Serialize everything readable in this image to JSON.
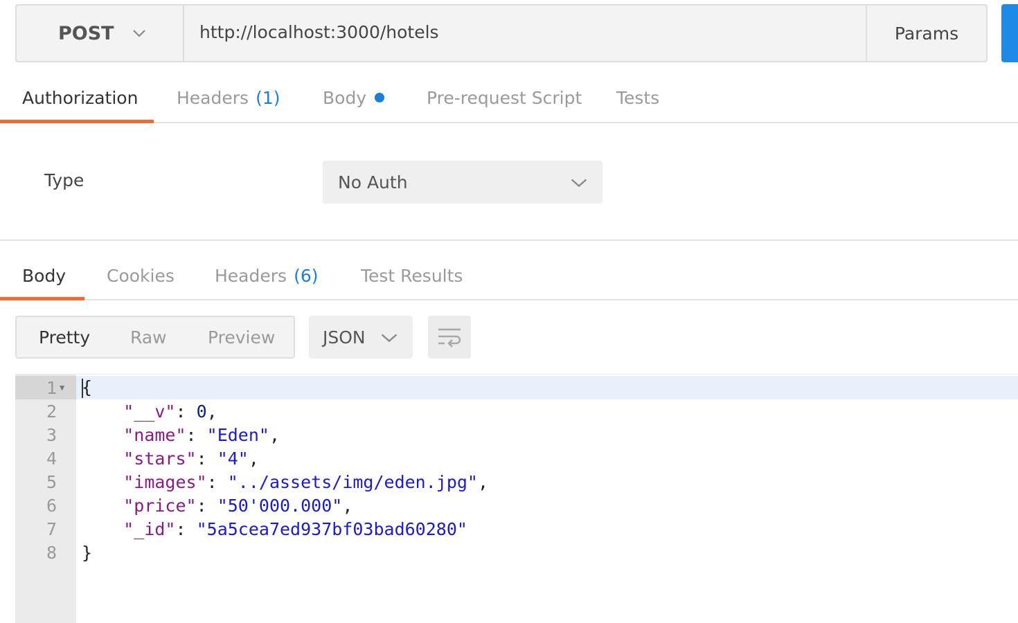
{
  "request": {
    "method": "POST",
    "url": "http://localhost:3000/hotels",
    "params_label": "Params"
  },
  "request_tabs": [
    {
      "label": "Authorization",
      "active": true
    },
    {
      "label": "Headers",
      "count": "(1)"
    },
    {
      "label": "Body",
      "has_dot": true
    },
    {
      "label": "Pre-request Script"
    },
    {
      "label": "Tests"
    }
  ],
  "auth": {
    "type_label": "Type",
    "selected": "No Auth"
  },
  "response_tabs": [
    {
      "label": "Body",
      "active": true
    },
    {
      "label": "Cookies"
    },
    {
      "label": "Headers",
      "count": "(6)"
    },
    {
      "label": "Test Results"
    }
  ],
  "view_modes": [
    {
      "label": "Pretty",
      "active": true
    },
    {
      "label": "Raw"
    },
    {
      "label": "Preview"
    }
  ],
  "format": "JSON",
  "response_body": {
    "lines": [
      {
        "num": "1",
        "open": "{"
      },
      {
        "num": "2",
        "key": "\"__v\"",
        "value": "0",
        "value_type": "number",
        "comma": ","
      },
      {
        "num": "3",
        "key": "\"name\"",
        "value": "\"Eden\"",
        "value_type": "string",
        "comma": ","
      },
      {
        "num": "4",
        "key": "\"stars\"",
        "value": "\"4\"",
        "value_type": "string",
        "comma": ","
      },
      {
        "num": "5",
        "key": "\"images\"",
        "value": "\"../assets/img/eden.jpg\"",
        "value_type": "string",
        "comma": ","
      },
      {
        "num": "6",
        "key": "\"price\"",
        "value": "\"50'000.000\"",
        "value_type": "string",
        "comma": ","
      },
      {
        "num": "7",
        "key": "\"_id\"",
        "value": "\"5a5cea7ed937bf03bad60280\"",
        "value_type": "string",
        "comma": ""
      },
      {
        "num": "8",
        "close": "}"
      }
    ]
  },
  "colors": {
    "accent_underline": "#f06a34",
    "count_blue": "#1a7fdc",
    "send_blue": "#1e8ae8",
    "json_key": "#8a1a8a",
    "json_string": "#1a1ad6",
    "json_number": "#0b1f8a"
  }
}
